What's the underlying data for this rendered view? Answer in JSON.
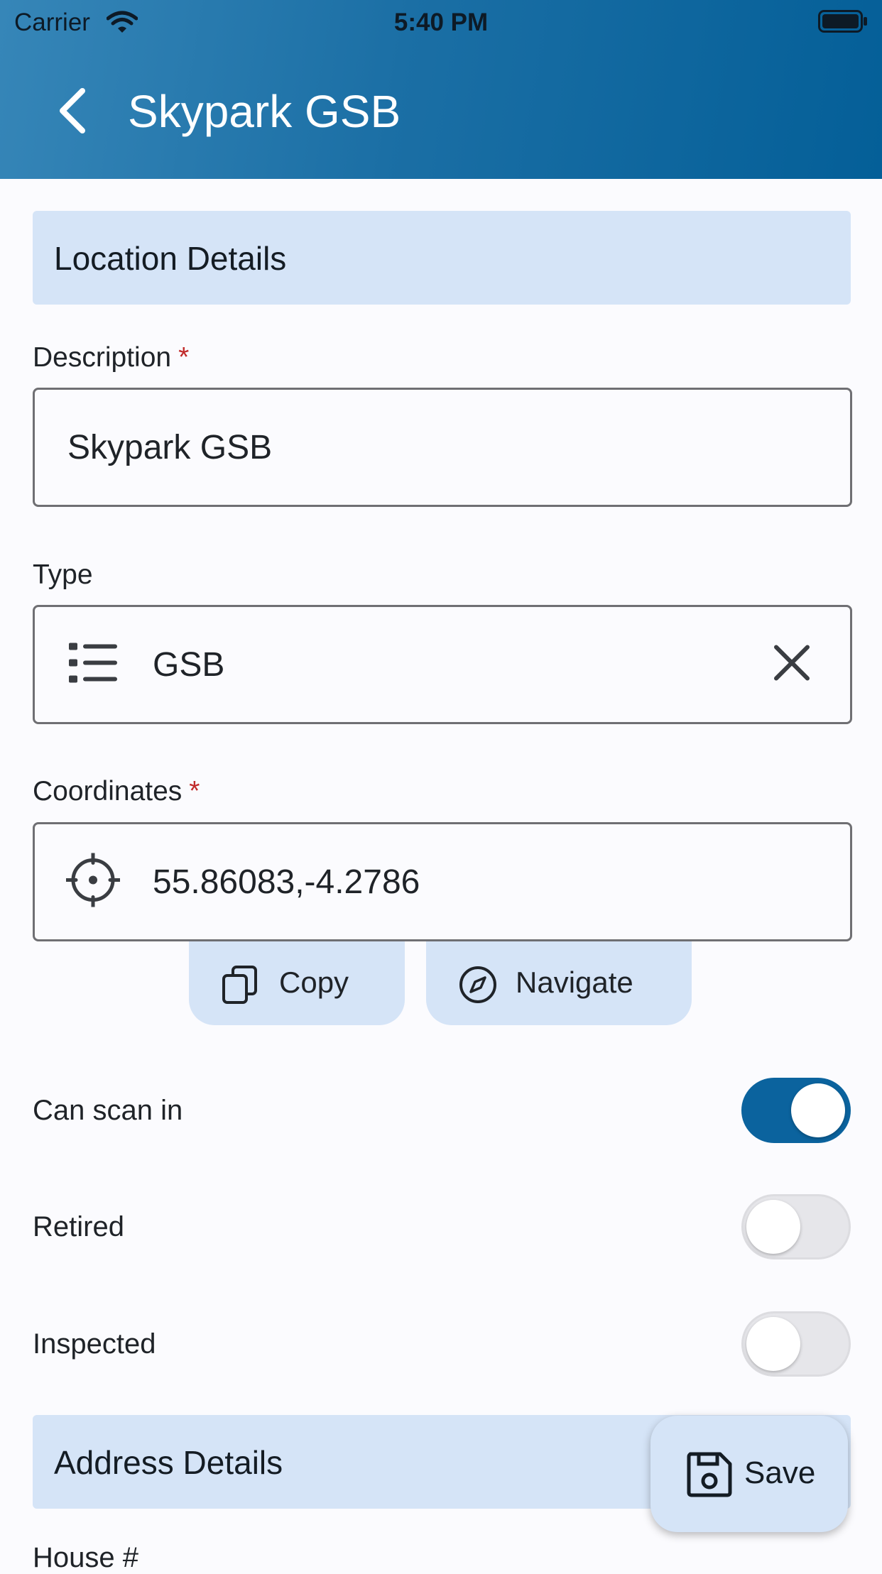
{
  "status_bar": {
    "carrier": "Carrier",
    "time": "5:40 PM"
  },
  "header": {
    "title": "Skypark GSB"
  },
  "sections": {
    "location": "Location Details",
    "address": "Address Details"
  },
  "fields": {
    "description": {
      "label": "Description",
      "required_mark": "*",
      "value": "Skypark GSB"
    },
    "type": {
      "label": "Type",
      "value": "GSB"
    },
    "coordinates": {
      "label": "Coordinates",
      "required_mark": "*",
      "value": "55.86083,-4.2786"
    }
  },
  "actions": {
    "copy": "Copy",
    "navigate": "Navigate"
  },
  "toggles": [
    {
      "label": "Can scan in",
      "on": true
    },
    {
      "label": "Retired",
      "on": false
    },
    {
      "label": "Inspected",
      "on": false
    }
  ],
  "address": {
    "house_label": "House #"
  },
  "fab": {
    "save": "Save"
  },
  "colors": {
    "accent": "#0b639e",
    "section_bg": "#d5e4f7",
    "required": "#c12a2a"
  }
}
